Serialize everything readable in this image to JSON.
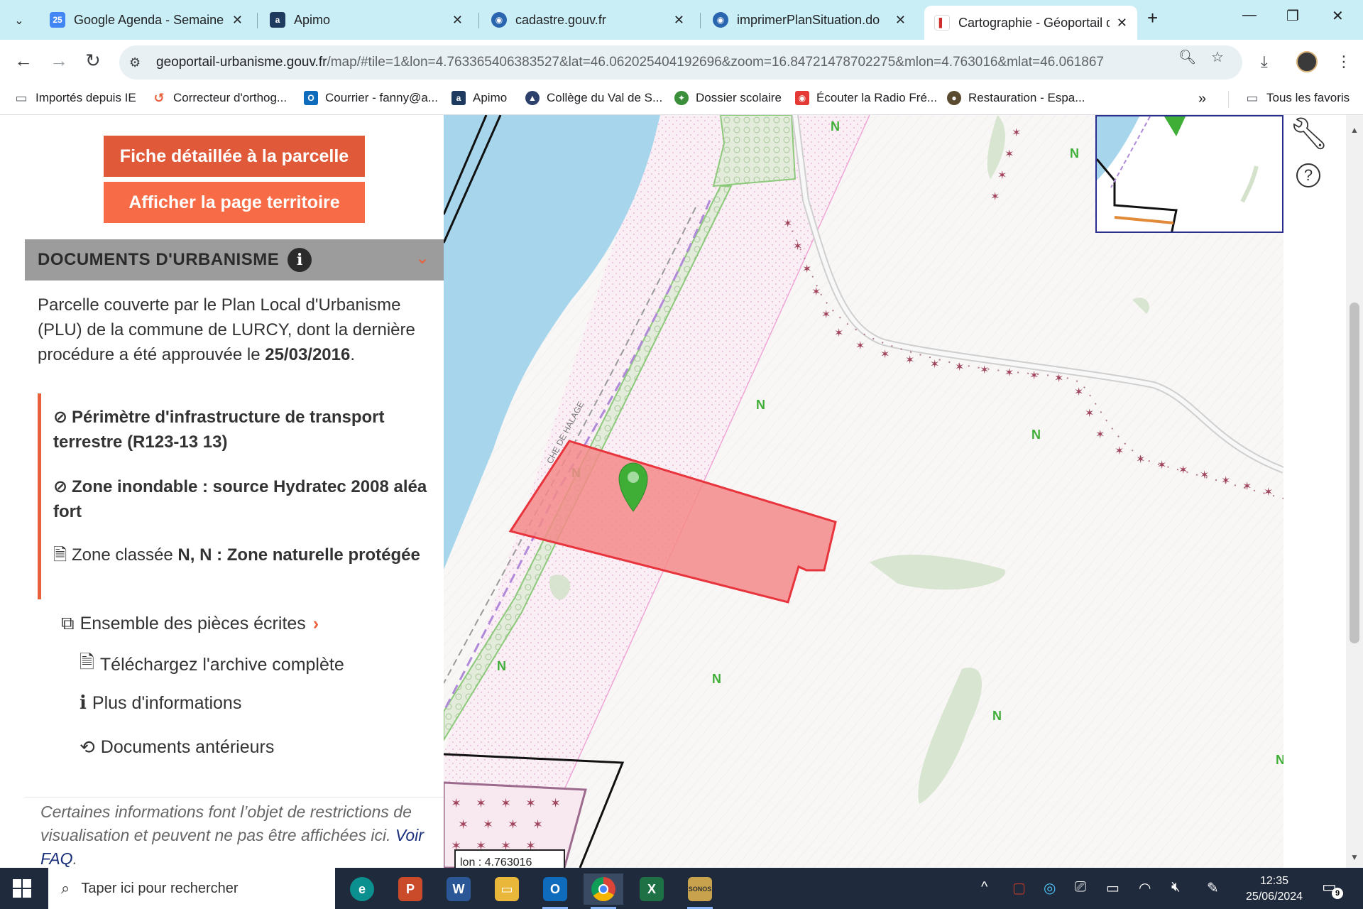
{
  "browser": {
    "tabs": [
      {
        "title": "Google Agenda - Semaine d",
        "favicon_label": "25",
        "color": "#4285f4"
      },
      {
        "title": "Apimo",
        "favicon_label": "a",
        "color": "#1e3a5f"
      },
      {
        "title": "cadastre.gouv.fr",
        "favicon_label": "◉",
        "color": "#2a66b0"
      },
      {
        "title": "imprimerPlanSituation.do",
        "favicon_label": "◉",
        "color": "#2a66b0"
      },
      {
        "title": "Cartographie - Géoportail d",
        "favicon_label": "▌",
        "color": "#d12c2c"
      }
    ],
    "url_domain": "geoportail-urbanisme.gouv.fr",
    "url_path": "/map/#tile=1&lon=4.763365406383527&lat=46.062025404192696&zoom=16.84721478702275&mlon=4.763016&mlat=46.061867",
    "bookmarks": [
      {
        "label": "Importés depuis IE",
        "icon": "folder-icon",
        "color": "#5f6368"
      },
      {
        "label": "Correcteur d'orthog...",
        "icon": "spellcheck-icon",
        "color": "#e8603c"
      },
      {
        "label": "Courrier - fanny@a...",
        "icon": "outlook-icon",
        "color": "#0f6cbd"
      },
      {
        "label": "Apimo",
        "icon": "apimo-icon",
        "color": "#1e3a5f"
      },
      {
        "label": "Collège du Val de S...",
        "icon": "college-icon",
        "color": "#2d3f6b"
      },
      {
        "label": "Dossier scolaire",
        "icon": "school-icon",
        "color": "#3b8f3b"
      },
      {
        "label": "Écouter la Radio Fré...",
        "icon": "radio-icon",
        "color": "#e53935"
      },
      {
        "label": "Restauration - Espa...",
        "icon": "restaurant-icon",
        "color": "#5a4a2f"
      }
    ],
    "all_bookmarks_label": "Tous les favoris"
  },
  "panel": {
    "btn_fiche": "Fiche détaillée à la parcelle",
    "btn_territoire": "Afficher la page territoire",
    "section_title": "DOCUMENTS D'URBANISME",
    "plu_text": "Parcelle couverte par le Plan Local d'Urbanisme (PLU) de la commune de LURCY, dont la dernière procédure a été approuvée le",
    "plu_date": "25/03/2016",
    "rules": [
      {
        "text": "Périmètre d'infrastructure de transport terrestre (R123-13 13)"
      },
      {
        "text": "Zone inondable : source Hydratec 2008 aléa fort"
      },
      {
        "prefix": "Zone classée",
        "code": "N, N : Zone naturelle protégée"
      }
    ],
    "link_pieces": "Ensemble des pièces écrites",
    "link_archive": "Téléchargez l'archive complète",
    "link_info": "Plus d'informations",
    "link_anterieurs": "Documents antérieurs",
    "note": "Certaines informations font l’objet de restrictions de visualisation et peuvent ne pas être affichées ici.",
    "note_link": "Voir FAQ"
  },
  "map": {
    "zone_label": "N",
    "road_label": "CHE DE HALAGE",
    "coord_label": "lon : 4.763016"
  },
  "taskbar": {
    "search_placeholder": "Taper ici pour rechercher",
    "time": "12:35",
    "date": "25/06/2024",
    "notif_count": "9"
  },
  "colors": {
    "accent_red": "#e05a3a",
    "accent_orange": "#f76c46",
    "parcel_fill": "#f58a8a",
    "parcel_stroke": "#e8343c",
    "marker_green": "#3fae36"
  }
}
